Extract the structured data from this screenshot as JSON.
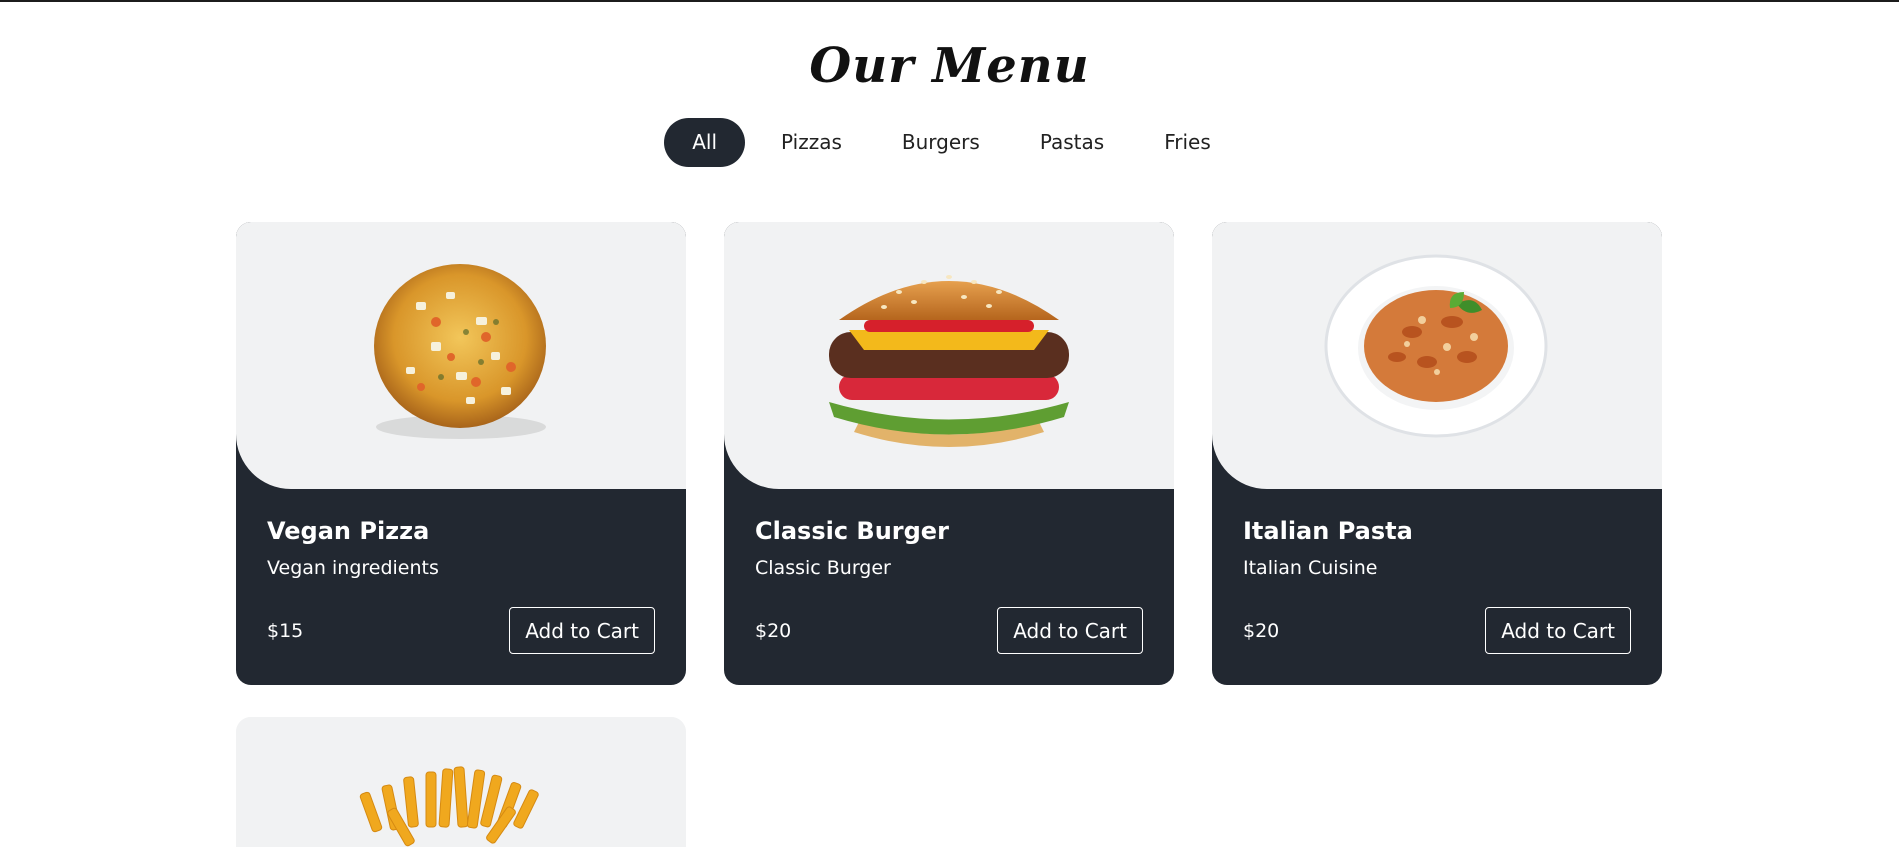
{
  "menu": {
    "title": "Our Menu",
    "filters": [
      {
        "label": "All",
        "active": true
      },
      {
        "label": "Pizzas",
        "active": false
      },
      {
        "label": "Burgers",
        "active": false
      },
      {
        "label": "Pastas",
        "active": false
      },
      {
        "label": "Fries",
        "active": false
      }
    ],
    "items": [
      {
        "name": "Vegan Pizza",
        "description": "Vegan ingredients",
        "price": "$15",
        "button": "Add to Cart",
        "image": "pizza"
      },
      {
        "name": "Classic Burger",
        "description": "Classic Burger",
        "price": "$20",
        "button": "Add to Cart",
        "image": "burger"
      },
      {
        "name": "Italian Pasta",
        "description": "Italian Cuisine",
        "price": "$20",
        "button": "Add to Cart",
        "image": "pasta"
      },
      {
        "image": "fries"
      }
    ]
  },
  "colors": {
    "card_dark": "#222831",
    "image_bg": "#f1f2f3",
    "active_filter_bg": "#222831"
  }
}
